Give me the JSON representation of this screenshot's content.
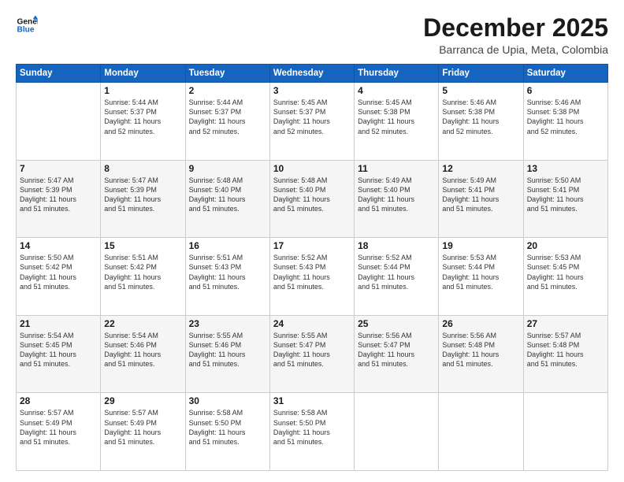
{
  "header": {
    "logo_line1": "General",
    "logo_line2": "Blue",
    "month": "December 2025",
    "location": "Barranca de Upia, Meta, Colombia"
  },
  "days_of_week": [
    "Sunday",
    "Monday",
    "Tuesday",
    "Wednesday",
    "Thursday",
    "Friday",
    "Saturday"
  ],
  "weeks": [
    [
      {
        "day": "",
        "info": ""
      },
      {
        "day": "1",
        "info": "Sunrise: 5:44 AM\nSunset: 5:37 PM\nDaylight: 11 hours\nand 52 minutes."
      },
      {
        "day": "2",
        "info": "Sunrise: 5:44 AM\nSunset: 5:37 PM\nDaylight: 11 hours\nand 52 minutes."
      },
      {
        "day": "3",
        "info": "Sunrise: 5:45 AM\nSunset: 5:37 PM\nDaylight: 11 hours\nand 52 minutes."
      },
      {
        "day": "4",
        "info": "Sunrise: 5:45 AM\nSunset: 5:38 PM\nDaylight: 11 hours\nand 52 minutes."
      },
      {
        "day": "5",
        "info": "Sunrise: 5:46 AM\nSunset: 5:38 PM\nDaylight: 11 hours\nand 52 minutes."
      },
      {
        "day": "6",
        "info": "Sunrise: 5:46 AM\nSunset: 5:38 PM\nDaylight: 11 hours\nand 52 minutes."
      }
    ],
    [
      {
        "day": "7",
        "info": "Sunrise: 5:47 AM\nSunset: 5:39 PM\nDaylight: 11 hours\nand 51 minutes."
      },
      {
        "day": "8",
        "info": "Sunrise: 5:47 AM\nSunset: 5:39 PM\nDaylight: 11 hours\nand 51 minutes."
      },
      {
        "day": "9",
        "info": "Sunrise: 5:48 AM\nSunset: 5:40 PM\nDaylight: 11 hours\nand 51 minutes."
      },
      {
        "day": "10",
        "info": "Sunrise: 5:48 AM\nSunset: 5:40 PM\nDaylight: 11 hours\nand 51 minutes."
      },
      {
        "day": "11",
        "info": "Sunrise: 5:49 AM\nSunset: 5:40 PM\nDaylight: 11 hours\nand 51 minutes."
      },
      {
        "day": "12",
        "info": "Sunrise: 5:49 AM\nSunset: 5:41 PM\nDaylight: 11 hours\nand 51 minutes."
      },
      {
        "day": "13",
        "info": "Sunrise: 5:50 AM\nSunset: 5:41 PM\nDaylight: 11 hours\nand 51 minutes."
      }
    ],
    [
      {
        "day": "14",
        "info": "Sunrise: 5:50 AM\nSunset: 5:42 PM\nDaylight: 11 hours\nand 51 minutes."
      },
      {
        "day": "15",
        "info": "Sunrise: 5:51 AM\nSunset: 5:42 PM\nDaylight: 11 hours\nand 51 minutes."
      },
      {
        "day": "16",
        "info": "Sunrise: 5:51 AM\nSunset: 5:43 PM\nDaylight: 11 hours\nand 51 minutes."
      },
      {
        "day": "17",
        "info": "Sunrise: 5:52 AM\nSunset: 5:43 PM\nDaylight: 11 hours\nand 51 minutes."
      },
      {
        "day": "18",
        "info": "Sunrise: 5:52 AM\nSunset: 5:44 PM\nDaylight: 11 hours\nand 51 minutes."
      },
      {
        "day": "19",
        "info": "Sunrise: 5:53 AM\nSunset: 5:44 PM\nDaylight: 11 hours\nand 51 minutes."
      },
      {
        "day": "20",
        "info": "Sunrise: 5:53 AM\nSunset: 5:45 PM\nDaylight: 11 hours\nand 51 minutes."
      }
    ],
    [
      {
        "day": "21",
        "info": "Sunrise: 5:54 AM\nSunset: 5:45 PM\nDaylight: 11 hours\nand 51 minutes."
      },
      {
        "day": "22",
        "info": "Sunrise: 5:54 AM\nSunset: 5:46 PM\nDaylight: 11 hours\nand 51 minutes."
      },
      {
        "day": "23",
        "info": "Sunrise: 5:55 AM\nSunset: 5:46 PM\nDaylight: 11 hours\nand 51 minutes."
      },
      {
        "day": "24",
        "info": "Sunrise: 5:55 AM\nSunset: 5:47 PM\nDaylight: 11 hours\nand 51 minutes."
      },
      {
        "day": "25",
        "info": "Sunrise: 5:56 AM\nSunset: 5:47 PM\nDaylight: 11 hours\nand 51 minutes."
      },
      {
        "day": "26",
        "info": "Sunrise: 5:56 AM\nSunset: 5:48 PM\nDaylight: 11 hours\nand 51 minutes."
      },
      {
        "day": "27",
        "info": "Sunrise: 5:57 AM\nSunset: 5:48 PM\nDaylight: 11 hours\nand 51 minutes."
      }
    ],
    [
      {
        "day": "28",
        "info": "Sunrise: 5:57 AM\nSunset: 5:49 PM\nDaylight: 11 hours\nand 51 minutes."
      },
      {
        "day": "29",
        "info": "Sunrise: 5:57 AM\nSunset: 5:49 PM\nDaylight: 11 hours\nand 51 minutes."
      },
      {
        "day": "30",
        "info": "Sunrise: 5:58 AM\nSunset: 5:50 PM\nDaylight: 11 hours\nand 51 minutes."
      },
      {
        "day": "31",
        "info": "Sunrise: 5:58 AM\nSunset: 5:50 PM\nDaylight: 11 hours\nand 51 minutes."
      },
      {
        "day": "",
        "info": ""
      },
      {
        "day": "",
        "info": ""
      },
      {
        "day": "",
        "info": ""
      }
    ]
  ]
}
